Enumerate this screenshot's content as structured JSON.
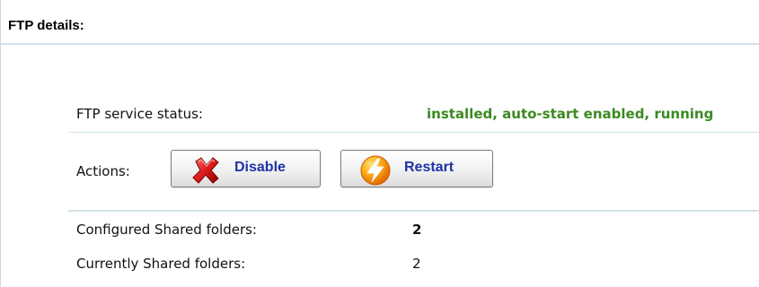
{
  "page": {
    "title": "FTP details:"
  },
  "service": {
    "status_label": "FTP service status:",
    "status_value": "installed, auto-start enabled, running",
    "status_color": "#3b8a22"
  },
  "actions": {
    "label": "Actions:",
    "disable_label": "Disable",
    "restart_label": "Restart",
    "icons": [
      "x-icon",
      "lightning-icon"
    ]
  },
  "folders": {
    "configured_label": "Configured Shared folders:",
    "configured_value": "2",
    "currently_label": "Currently Shared folders:",
    "currently_value": "2"
  },
  "colors": {
    "accent_line": "#cfe3e7",
    "button_text": "#1f32a8"
  }
}
